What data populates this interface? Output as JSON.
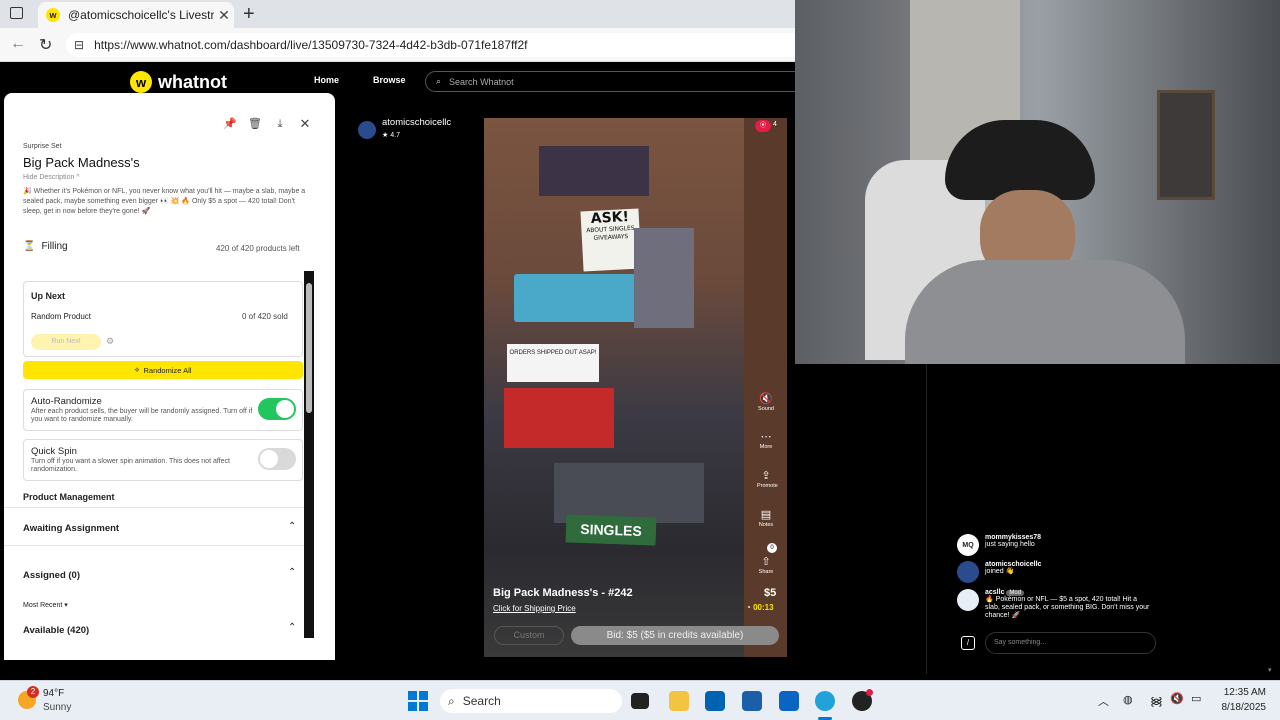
{
  "browser": {
    "tab_title": "@atomicschoicellc's Livestream o",
    "tab_close": "✕",
    "new_tab": "+",
    "url": "https://www.whatnot.com/dashboard/live/13509730-7324-4d42-b3db-071fe187ff2f"
  },
  "header": {
    "logo": "whatnot",
    "nav_home": "Home",
    "nav_browse": "Browse",
    "search_placeholder": "Search Whatnot"
  },
  "panel": {
    "category": "Surprise Set",
    "title": "Big Pack Madness's",
    "hide_description": "Hide Description ^",
    "description": "🎉 Whether it's Pokémon or NFL, you never know what you'll hit — maybe a slab, maybe a sealed pack, maybe something even bigger 👀 💥 🔥 Only $5 a spot — 420 total! Don't sleep, get in now before they're gone! 🚀",
    "status_label": "Filling",
    "status_count": "420 of 420 products left",
    "up_next": {
      "heading": "Up Next",
      "item": "Random Product",
      "sold": "0 of 420 sold",
      "run_next": "Run Next"
    },
    "randomize_all": "Randomize All",
    "auto_randomize": {
      "title": "Auto-Randomize",
      "desc": "After each product sells, the buyer will be randomly assigned. Turn off if you want to randomize manually.",
      "on": true
    },
    "quick_spin": {
      "title": "Quick Spin",
      "desc": "Turn off if you want a slower spin animation. This does not affect randomization.",
      "on": false
    },
    "product_management": "Product Management",
    "awaiting": "Awaiting Assignment",
    "assigned": "Assigned (0)",
    "sort": "Most Recent",
    "available": "Available (420)"
  },
  "stream": {
    "host": "atomicschoicellc",
    "rating": "4.7",
    "viewers": "4",
    "sign_ask": "ASK!",
    "sign_sub": "ABOUT SINGLES GIVEAWAYS",
    "sign_orders": "ORDERS SHIPPED OUT ASAP!",
    "sign_singles": "SINGLES",
    "show_title": "Big Pack Madness's - #242",
    "price": "$5",
    "shipping": "Click for Shipping Price",
    "timer": "00:13",
    "custom": "Custom",
    "bid": "Bid: $5 ($5 in credits available)",
    "side": [
      {
        "icon": "🔇",
        "label": "Sound"
      },
      {
        "icon": "⋯",
        "label": "More"
      },
      {
        "icon": "⇪",
        "label": "Promote"
      },
      {
        "icon": "▤",
        "label": "Notes"
      },
      {
        "icon": "⇧",
        "label": "Share"
      }
    ],
    "share_badge": "0"
  },
  "chat": {
    "messages": [
      {
        "initials": "MQ",
        "name": "mommykisses78",
        "text": "just saying hello"
      },
      {
        "initials": "",
        "name": "atomicschoicellc",
        "text": "joined 👋"
      },
      {
        "initials": "",
        "name": "acsllc",
        "badge": "Mod",
        "text": "🔥 Pokémon or NFL — $5 a spot, 420 total! Hit a slab, sealed pack, or something BIG. Don't miss your chance! 🚀"
      }
    ],
    "input_placeholder": "Say something..."
  },
  "taskbar": {
    "weather_temp": "94°F",
    "weather_desc": "Sunny",
    "weather_badge": "2",
    "search": "Search",
    "time": "12:35 AM",
    "date": "8/18/2025"
  },
  "colors": {
    "accent_yellow": "#ffe500",
    "toggle_on": "#22c55e",
    "toggle_off": "#d9d9d9",
    "live_red": "#e11d48"
  }
}
